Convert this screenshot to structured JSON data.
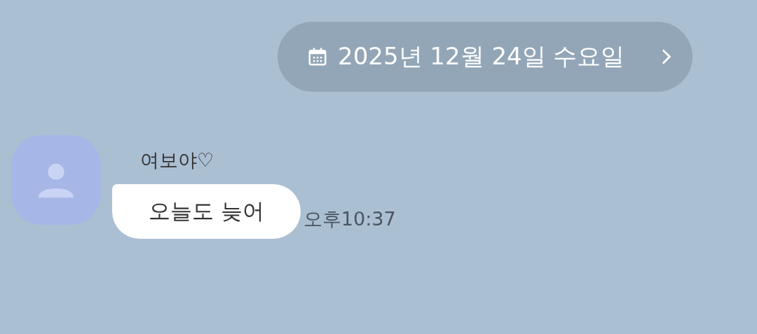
{
  "date_divider": {
    "text": "2025년 12월 24일 수요일"
  },
  "messages": [
    {
      "sender": "여보야♡",
      "text": "오늘도 늦어",
      "time": "오후10:37"
    }
  ]
}
